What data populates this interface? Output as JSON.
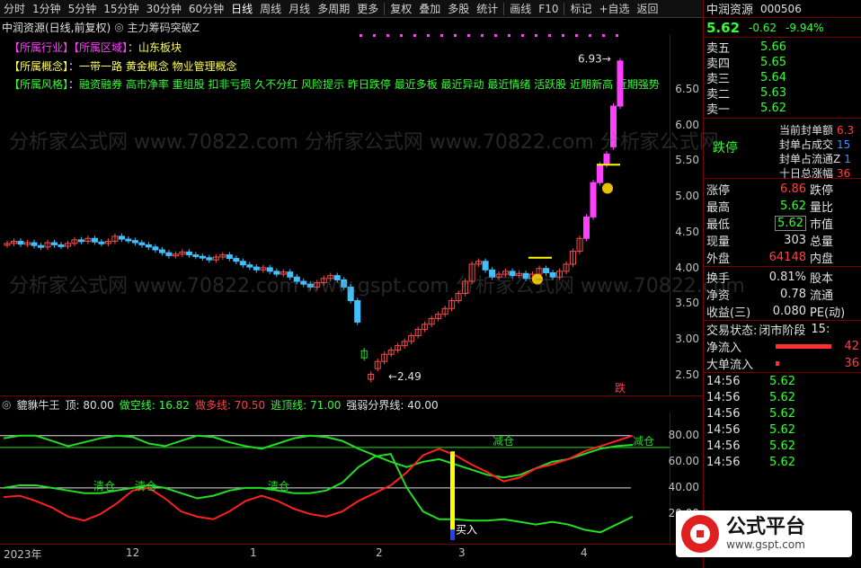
{
  "toolbar": {
    "items": [
      "分时",
      "1分钟",
      "5分钟",
      "15分钟",
      "30分钟",
      "60分钟",
      "日线",
      "周线",
      "月线",
      "多周期",
      "更多",
      "复权",
      "叠加",
      "多股",
      "统计",
      "画线",
      "F10",
      "标记",
      "+自选",
      "返回"
    ],
    "active": "日线"
  },
  "chart_header": {
    "stock": "中润资源(日线,前复权)",
    "formula": "主力筹码突破Z"
  },
  "info": {
    "industry_label": "【所属行业】",
    "region_label": "【所属区域】",
    "region_value": "山东板块",
    "concept_label": "【所属概念】",
    "concept_value": "一带一路 黄金概念 物业管理概念",
    "style_label": "【所属风格】",
    "style_value": "融资融券 高市净率 重组股 扣非亏损 久不分红 风险提示 昨日跌停 最近多板 最近异动 最近情绪 活跃股 近期新高 近期强势"
  },
  "price_axis": [
    "6.50",
    "6.00",
    "5.50",
    "5.00",
    "4.50",
    "4.00",
    "3.50",
    "3.00",
    "2.50"
  ],
  "annotations": {
    "high": "6.93",
    "low": "2.49",
    "tag": "跌"
  },
  "indicator": {
    "name": "貔貅牛王",
    "items": [
      {
        "label": "顶: 80.00",
        "color": "#e0e0e0"
      },
      {
        "label": "做空线: 16.82",
        "color": "#33ff33"
      },
      {
        "label": "做多线: 70.50",
        "color": "#ff4040"
      },
      {
        "label": "逃顶线: 71.00",
        "color": "#33ff33"
      },
      {
        "label": "强弱分界线: 40.00",
        "color": "#e0e0e0"
      }
    ],
    "axis": [
      "80.00",
      "60.00",
      "40.00",
      "20.00"
    ],
    "labels": {
      "clear1": "清仓",
      "clear2": "清仓",
      "clear3": "清仓",
      "reduce1": "减仓",
      "reduce2": "减仓",
      "buy": "买入"
    }
  },
  "date_axis": [
    "2023年",
    "12",
    "1",
    "2",
    "3",
    "4"
  ],
  "chart_data": {
    "type": "candlestick",
    "ylim": [
      2.3,
      7.2
    ],
    "title": "",
    "xlabel": "",
    "ylabel": "",
    "close": [
      4.35,
      4.38,
      4.34,
      4.36,
      4.32,
      4.3,
      4.36,
      4.33,
      4.31,
      4.35,
      4.4,
      4.38,
      4.42,
      4.37,
      4.35,
      4.38,
      4.45,
      4.41,
      4.39,
      4.36,
      4.33,
      4.3,
      4.26,
      4.22,
      4.18,
      4.2,
      4.23,
      4.19,
      4.17,
      4.15,
      4.12,
      4.16,
      4.19,
      4.14,
      4.1,
      4.05,
      4.02,
      3.98,
      4.01,
      3.96,
      3.92,
      3.95,
      3.88,
      3.82,
      3.78,
      3.74,
      3.8,
      3.86,
      3.9,
      3.84,
      3.74,
      3.55,
      3.25,
      2.85,
      2.52,
      2.7,
      2.8,
      2.86,
      2.92,
      2.98,
      3.06,
      3.15,
      3.22,
      3.3,
      3.36,
      3.44,
      3.55,
      3.65,
      3.82,
      4.06,
      4.1,
      3.98,
      3.88,
      3.92,
      3.96,
      3.9,
      3.93,
      3.86,
      3.92,
      4.0,
      3.94,
      3.88,
      3.96,
      4.06,
      4.24,
      4.42,
      4.72,
      5.2,
      5.45,
      5.6,
      6.27,
      6.9
    ],
    "open": [
      4.33,
      4.35,
      4.38,
      4.34,
      4.36,
      4.32,
      4.3,
      4.36,
      4.33,
      4.31,
      4.35,
      4.4,
      4.38,
      4.42,
      4.37,
      4.35,
      4.38,
      4.45,
      4.41,
      4.39,
      4.36,
      4.33,
      4.3,
      4.26,
      4.22,
      4.18,
      4.2,
      4.23,
      4.19,
      4.17,
      4.15,
      4.12,
      4.16,
      4.19,
      4.14,
      4.1,
      4.05,
      4.02,
      3.98,
      4.01,
      3.96,
      3.92,
      3.95,
      3.88,
      3.82,
      3.78,
      3.74,
      3.8,
      3.86,
      3.9,
      3.84,
      3.74,
      3.55,
      2.75,
      2.45,
      2.6,
      2.7,
      2.8,
      2.86,
      2.92,
      2.98,
      3.06,
      3.15,
      3.22,
      3.3,
      3.36,
      3.44,
      3.55,
      3.65,
      3.82,
      4.06,
      4.1,
      3.98,
      3.88,
      3.92,
      3.96,
      3.9,
      3.93,
      3.86,
      3.92,
      4.0,
      3.94,
      3.88,
      3.96,
      4.06,
      4.24,
      4.42,
      4.72,
      5.2,
      5.45,
      5.7,
      6.27
    ],
    "timing_x": [
      0,
      4,
      8,
      12,
      16,
      20,
      24,
      28,
      32,
      36,
      40,
      44,
      48,
      52,
      56,
      60,
      64,
      68,
      72,
      76,
      80,
      84,
      88,
      92
    ],
    "ind_line1": [
      78,
      80,
      80,
      76,
      72,
      75,
      78,
      80,
      79,
      74,
      72,
      76,
      80,
      79,
      75,
      72,
      70,
      74,
      78,
      80,
      79,
      76,
      70,
      65,
      60,
      56,
      60,
      62,
      58,
      54,
      50,
      48,
      50,
      55,
      60,
      62,
      66,
      70,
      72,
      73
    ],
    "ind_line2": [
      33,
      34,
      30,
      25,
      18,
      15,
      20,
      28,
      38,
      40,
      32,
      22,
      18,
      16,
      22,
      30,
      34,
      30,
      24,
      20,
      18,
      22,
      30,
      36,
      42,
      52,
      65,
      70,
      65,
      58,
      52,
      45,
      48,
      55,
      58,
      62,
      68,
      72,
      76,
      80
    ],
    "ind_line3": [
      40,
      42,
      42,
      40,
      38,
      36,
      36,
      38,
      40,
      42,
      40,
      36,
      32,
      34,
      38,
      40,
      40,
      38,
      36,
      36,
      38,
      44,
      56,
      64,
      66,
      40,
      22,
      16,
      16,
      15,
      15,
      16,
      14,
      12,
      14,
      12,
      8,
      6,
      12,
      18
    ]
  }
}
